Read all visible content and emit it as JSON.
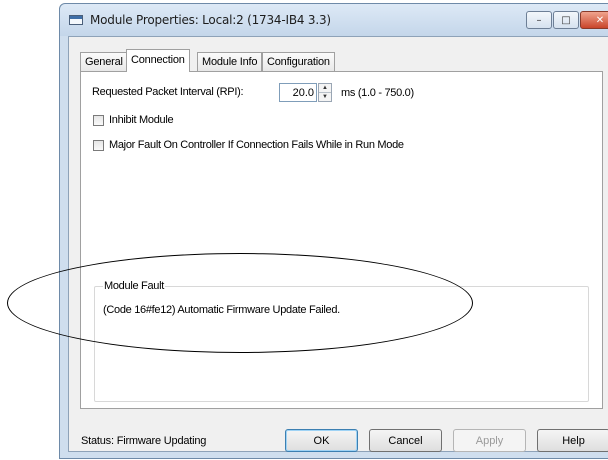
{
  "window": {
    "title": "Module Properties: Local:2 (1734-IB4 3.3)",
    "controls": {
      "minimize": "–",
      "maximize": "□",
      "close": "✕"
    }
  },
  "tabs": [
    {
      "label": "General",
      "active": false
    },
    {
      "label": "Connection",
      "active": true
    },
    {
      "label": "Module Info",
      "active": false
    },
    {
      "label": "Configuration",
      "active": false
    }
  ],
  "connection": {
    "rpi_label": "Requested Packet Interval (RPI):",
    "rpi_value": "20.0",
    "rpi_units": "ms (1.0 - 750.0)",
    "inhibit_label": "Inhibit Module",
    "inhibit_checked": false,
    "major_fault_label": "Major Fault On Controller If Connection Fails While in Run Mode",
    "major_fault_checked": false,
    "module_fault_title": "Module Fault",
    "module_fault_text": "(Code 16#fe12) Automatic Firmware Update Failed."
  },
  "footer": {
    "status": "Status:  Firmware Updating",
    "buttons": {
      "ok": "OK",
      "cancel": "Cancel",
      "apply": "Apply",
      "help": "Help"
    }
  },
  "icons": {
    "spin_up": "▲",
    "spin_down": "▼",
    "window_icon": "app-window-icon"
  }
}
